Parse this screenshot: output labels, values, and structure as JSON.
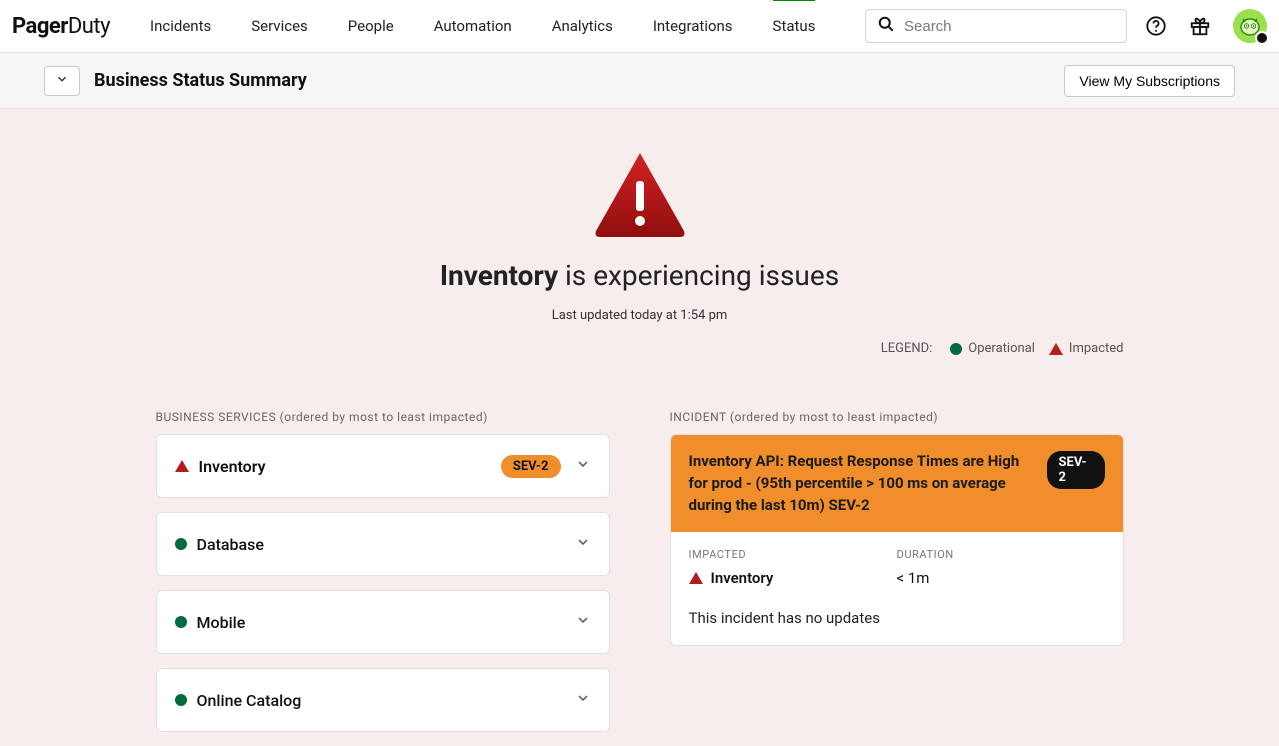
{
  "logo": {
    "pager": "Pager",
    "duty": "Duty"
  },
  "nav": {
    "items": [
      "Incidents",
      "Services",
      "People",
      "Automation",
      "Analytics",
      "Integrations",
      "Status"
    ],
    "activeIndex": 6
  },
  "search": {
    "placeholder": "Search"
  },
  "subheader": {
    "title": "Business Status Summary",
    "subscriptions_button": "View My Subscriptions"
  },
  "banner": {
    "service": "Inventory",
    "suffix": " is experiencing issues",
    "last_updated": "Last updated today at 1:54 pm"
  },
  "legend": {
    "label": "LEGEND:",
    "operational": "Operational",
    "impacted": "Impacted"
  },
  "sections": {
    "services_label_caps": "BUSINESS SERVICES",
    "services_label_note": " (ordered by most to least impacted)",
    "incident_label_caps": "INCIDENT",
    "incident_label_note": " (ordered by most to least impacted)"
  },
  "services": [
    {
      "name": "Inventory",
      "status": "impacted",
      "sev": "SEV-2"
    },
    {
      "name": "Database",
      "status": "operational",
      "sev": null
    },
    {
      "name": "Mobile",
      "status": "operational",
      "sev": null
    },
    {
      "name": "Online Catalog",
      "status": "operational",
      "sev": null
    }
  ],
  "incident": {
    "title": "Inventory API: Request Response Times are High for prod - (95th percentile > 100 ms on average during the last 10m) SEV-2",
    "sev": "SEV-2",
    "impacted_label": "IMPACTED",
    "impacted_service": "Inventory",
    "duration_label": "DURATION",
    "duration_value": "< 1m",
    "updates_text": "This incident has no updates"
  },
  "colors": {
    "impacted_red": "#b01e1e",
    "operational_green": "#006b3d",
    "sev_orange": "#ef8e2a"
  }
}
